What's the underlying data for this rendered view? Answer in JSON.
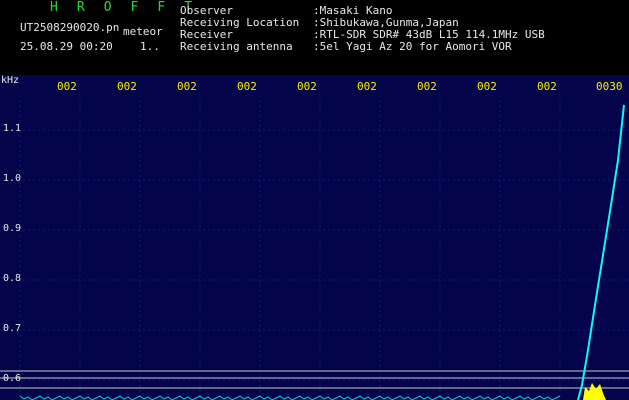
{
  "header": {
    "title": "H R O F F T",
    "file": "UT2508290020.pn",
    "meteor": "meteor",
    "datetime": "25.08.29 00:20",
    "count": "1..",
    "info": [
      {
        "label": "Observer",
        "value": ":Masaki Kano"
      },
      {
        "label": "Receiving Location",
        "value": ":Shibukawa,Gunma,Japan"
      },
      {
        "label": "Receiver",
        "value": ":RTL-SDR SDR# 43dB L15 114.1MHz USB"
      },
      {
        "label": "Receiving antenna",
        "value": ":5el Yagi Az 20 for Aomori VOR"
      }
    ]
  },
  "spectrogram": {
    "unit": "kHz",
    "y_ticks": [
      "1.1",
      "1.0",
      "0.9",
      "0.8",
      "0.7",
      "0.6"
    ],
    "x_ticks": [
      "002",
      "002",
      "002",
      "002",
      "002",
      "002",
      "002",
      "002",
      "002",
      "0030"
    ],
    "colors": {
      "background": "#04044a",
      "signal": "#00ffff",
      "burst": "#ffff00",
      "grid": "#0a1c7a",
      "reference_line": "#c8c8c8"
    }
  }
}
